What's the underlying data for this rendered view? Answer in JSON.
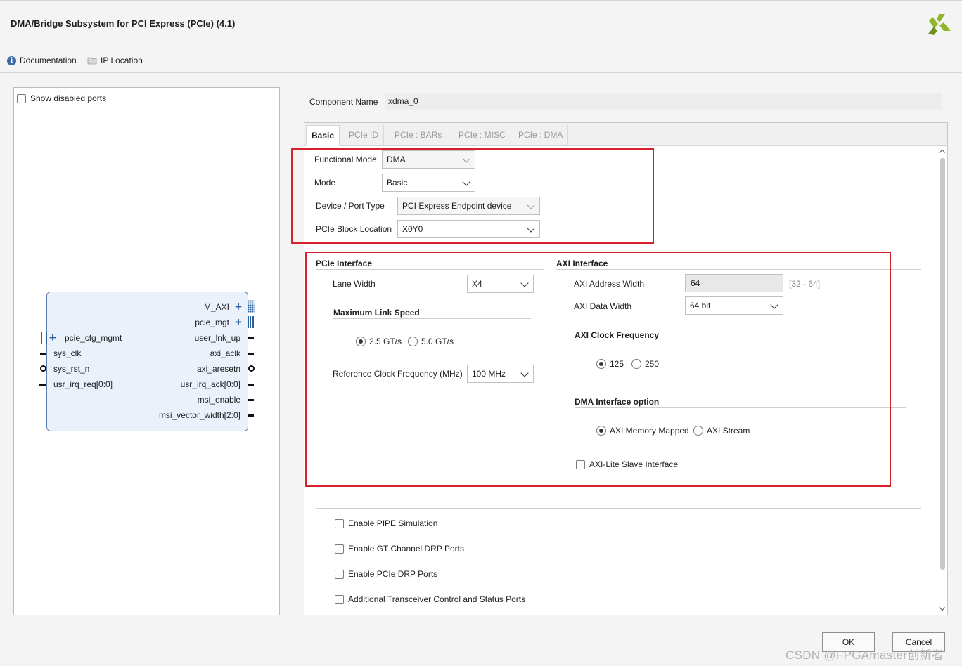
{
  "dialog": {
    "title": "DMA/Bridge Subsystem for PCI Express (PCIe) (4.1)"
  },
  "toolbar": {
    "documentation": "Documentation",
    "ip_location": "IP Location"
  },
  "left_pane": {
    "show_disabled_ports": "Show disabled ports",
    "show_disabled_ports_checked": false,
    "block": {
      "left_ports": [
        "pcie_cfg_mgmt",
        "sys_clk",
        "sys_rst_n",
        "usr_irq_req[0:0]"
      ],
      "right_ports": [
        "M_AXI",
        "pcie_mgt",
        "user_lnk_up",
        "axi_aclk",
        "axi_aresetn",
        "usr_irq_ack[0:0]",
        "msi_enable",
        "msi_vector_width[2:0]"
      ]
    }
  },
  "component": {
    "label": "Component Name",
    "value": "xdma_0"
  },
  "tabs": [
    "Basic",
    "PCIe ID",
    "PCIe : BARs",
    "PCIe : MISC",
    "PCIe : DMA"
  ],
  "active_tab": "Basic",
  "basic": {
    "functional_mode": {
      "label": "Functional Mode",
      "value": "DMA"
    },
    "mode": {
      "label": "Mode",
      "value": "Basic"
    },
    "device_port_type": {
      "label": "Device / Port Type",
      "value": "PCI Express Endpoint device"
    },
    "block_location": {
      "label": "PCIe Block Location",
      "value": "X0Y0"
    }
  },
  "pcie_interface": {
    "title": "PCIe Interface",
    "lane_width": {
      "label": "Lane Width",
      "value": "X4"
    },
    "max_link_speed": {
      "title": "Maximum Link Speed",
      "options": [
        "2.5 GT/s",
        "5.0 GT/s"
      ],
      "selected": "2.5 GT/s"
    },
    "ref_clock": {
      "label": "Reference Clock Frequency (MHz)",
      "value": "100 MHz"
    }
  },
  "axi_interface": {
    "title": "AXI Interface",
    "address_width": {
      "label": "AXI Address Width",
      "value": "64",
      "range": "[32 - 64]"
    },
    "data_width": {
      "label": "AXI Data Width",
      "value": "64 bit"
    },
    "clock_frequency": {
      "title": "AXI Clock Frequency",
      "options": [
        "125",
        "250"
      ],
      "selected": "125"
    },
    "dma_interface": {
      "title": "DMA Interface option",
      "options": [
        "AXI Memory Mapped",
        "AXI Stream"
      ],
      "selected": "AXI Memory Mapped"
    },
    "axi_lite_slave": {
      "label": "AXI-Lite Slave Interface",
      "checked": false
    }
  },
  "extra_options": [
    {
      "label": "Enable PIPE Simulation",
      "checked": false
    },
    {
      "label": "Enable GT Channel DRP Ports",
      "checked": false
    },
    {
      "label": "Enable PCIe DRP Ports",
      "checked": false
    },
    {
      "label": "Additional Transceiver Control and Status Ports",
      "checked": false
    }
  ],
  "buttons": {
    "ok": "OK",
    "cancel": "Cancel"
  },
  "watermark": "CSDN @FPGAmaster创新者",
  "colors": {
    "highlight_box": "#d8202a",
    "block_fill": "#eaf1fb",
    "port_accent": "#2b5fa3"
  }
}
